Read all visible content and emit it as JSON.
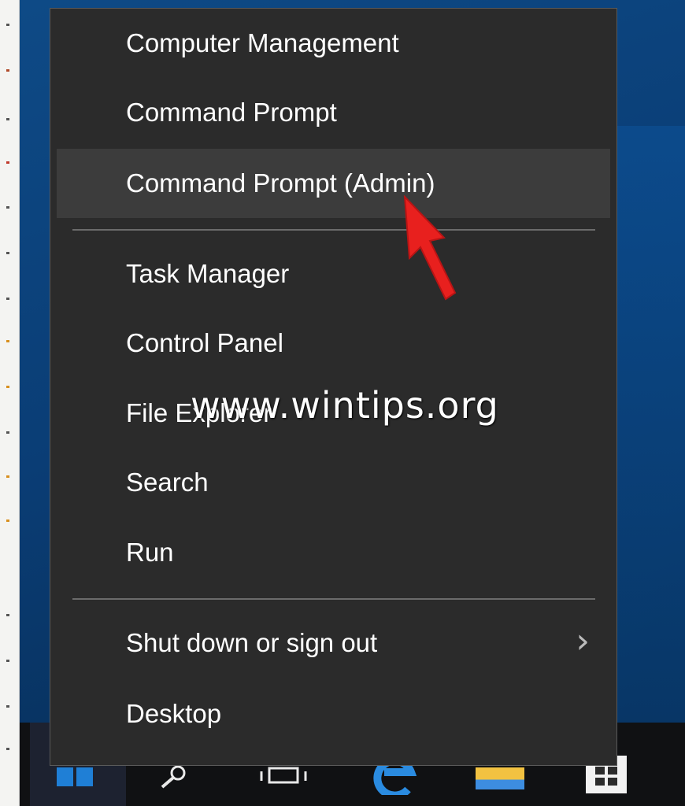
{
  "menu": {
    "items": [
      {
        "label": "Computer Management"
      },
      {
        "label": "Command Prompt"
      },
      {
        "label": "Command Prompt (Admin)"
      },
      {
        "label": "Task Manager"
      },
      {
        "label": "Control Panel"
      },
      {
        "label": "File Explorer"
      },
      {
        "label": "Search"
      },
      {
        "label": "Run"
      },
      {
        "label": "Shut down or sign out"
      },
      {
        "label": "Desktop"
      }
    ],
    "highlighted_item": "Command Prompt (Admin)",
    "submenu_indicator_icon": "chevron-right-icon"
  },
  "watermark": "www.wintips.org",
  "taskbar": {
    "icons": [
      "windows-logo-icon",
      "search-icon",
      "task-view-icon",
      "edge-icon",
      "file-explorer-icon",
      "store-icon"
    ]
  },
  "colors": {
    "menu_background": "#2b2b2b",
    "menu_hover": "#3c3c3c",
    "annotation_arrow": "#e8201e",
    "taskbar": "#101113"
  }
}
